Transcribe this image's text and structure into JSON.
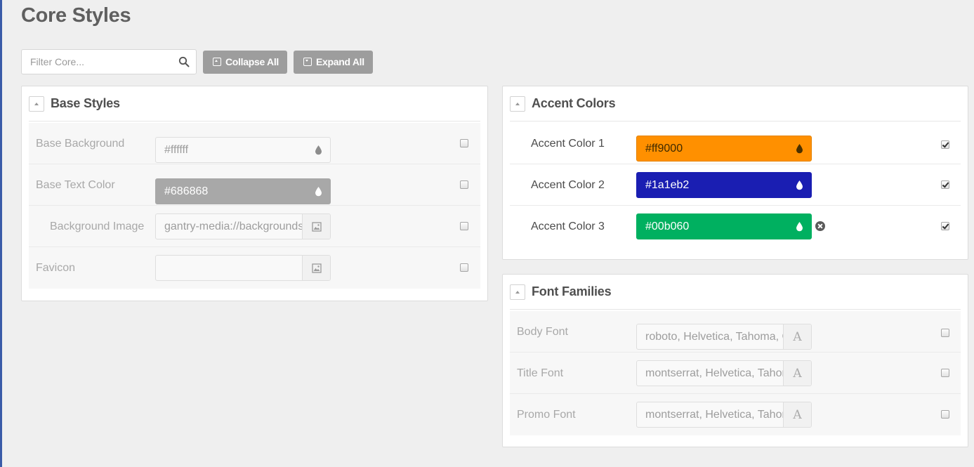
{
  "page": {
    "title": "Core Styles"
  },
  "toolbar": {
    "filter_placeholder": "Filter Core...",
    "collapse_label": "Collapse All",
    "expand_label": "Expand All"
  },
  "base_styles": {
    "title": "Base Styles",
    "rows": [
      {
        "label": "Base Background",
        "value": "#ffffff",
        "checked": false
      },
      {
        "label": "Base Text Color",
        "value": "#686868",
        "checked": false
      },
      {
        "label": "Background Image",
        "value": "gantry-media://backgrounds/",
        "checked": false
      },
      {
        "label": "Favicon",
        "value": "",
        "checked": false
      }
    ]
  },
  "accent_colors": {
    "title": "Accent Colors",
    "rows": [
      {
        "label": "Accent Color 1",
        "value": "#ff9000",
        "checked": true
      },
      {
        "label": "Accent Color 2",
        "value": "#1a1eb2",
        "checked": true
      },
      {
        "label": "Accent Color 3",
        "value": "#00b060",
        "checked": true
      }
    ]
  },
  "font_families": {
    "title": "Font Families",
    "rows": [
      {
        "label": "Body Font",
        "value": "roboto, Helvetica, Tahoma, Geneva, Arial, sans-serif",
        "checked": false
      },
      {
        "label": "Title Font",
        "value": "montserrat, Helvetica, Tahoma, Geneva, Arial, sans-serif",
        "checked": false
      },
      {
        "label": "Promo Font",
        "value": "montserrat, Helvetica, Tahoma, Geneva, Arial, sans-serif",
        "checked": false
      }
    ],
    "font_picker_glyph": "A"
  },
  "colors": {
    "accent_1": "#ff9000",
    "accent_2": "#1a1eb2",
    "accent_3": "#00b060",
    "base_text": "#686868",
    "base_background": "#ffffff"
  },
  "icons": {
    "search": "search-icon",
    "collapse": "collapse-icon",
    "expand": "expand-icon",
    "color_drop": "color-drop-icon",
    "image_picker": "image-picker-icon",
    "font_picker": "font-picker-icon",
    "clear": "clear-icon",
    "section_toggle": "chevron-up-icon"
  }
}
